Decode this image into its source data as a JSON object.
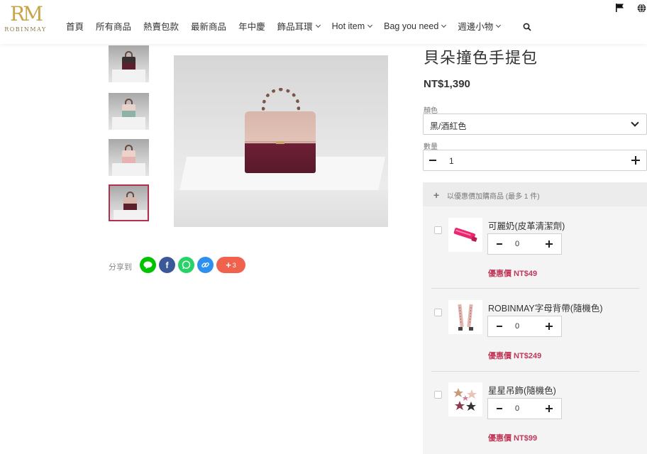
{
  "brand": {
    "logo_mark": "RM",
    "logo_text": "ROBINMAY"
  },
  "nav": {
    "items": [
      {
        "label": "首頁",
        "dropdown": false
      },
      {
        "label": "所有商品",
        "dropdown": false
      },
      {
        "label": "熱賣包款",
        "dropdown": false
      },
      {
        "label": "最新商品",
        "dropdown": false
      },
      {
        "label": "年中慶",
        "dropdown": false
      },
      {
        "label": "飾品耳環",
        "dropdown": true
      },
      {
        "label": "Hot item",
        "dropdown": true
      },
      {
        "label": "Bag you need",
        "dropdown": true
      },
      {
        "label": "週邊小物",
        "dropdown": true
      }
    ],
    "icons": [
      "search-icon",
      "flag-icon",
      "globe-icon"
    ]
  },
  "gallery": {
    "thumbnails": [
      {
        "top_color": "#3a2f30",
        "bottom_color": "#5c1f2c",
        "active": false
      },
      {
        "top_color": "#e7d3cc",
        "bottom_color": "#8fb2a8",
        "active": false
      },
      {
        "top_color": "#ecd2c8",
        "bottom_color": "#e6b3b3",
        "active": false
      },
      {
        "top_color": "#d9b8ac",
        "bottom_color": "#5c1f2c",
        "active": true
      }
    ]
  },
  "share": {
    "label": "分享到",
    "buttons": [
      {
        "name": "line-share-button",
        "icon": "line-icon",
        "color": "#00c300",
        "glyph": "●"
      },
      {
        "name": "facebook-share-button",
        "icon": "facebook-icon",
        "color": "#3b5998",
        "glyph": "f"
      },
      {
        "name": "whatsapp-share-button",
        "icon": "whatsapp-icon",
        "color": "#25d366",
        "glyph": "✆"
      },
      {
        "name": "copy-link-button",
        "icon": "link-icon",
        "color": "#2d8ff0",
        "glyph": "∞"
      }
    ],
    "more_plus": "+",
    "more_count": "3",
    "more_color": "#f0624d"
  },
  "product": {
    "title": "貝朵撞色手提包",
    "price": "NT$1,390",
    "color_label": "顏色",
    "color_value": "黑/酒紅色",
    "quantity_label": "數量",
    "quantity_value": "1"
  },
  "addons": {
    "header": "以優惠價加購商品 (最多 1 件)",
    "items": [
      {
        "name": "可麗奶(皮革清潔劑)",
        "quantity": "0",
        "price": "優惠價 NT$49",
        "icon": "cleaner-tube-icon"
      },
      {
        "name": "ROBINMAY字母背帶(隨機色)",
        "quantity": "0",
        "price": "優惠價 NT$249",
        "icon": "strap-icon"
      },
      {
        "name": "星星吊飾(隨機色)",
        "quantity": "0",
        "price": "優惠價 NT$99",
        "icon": "star-charm-icon"
      }
    ]
  },
  "colors": {
    "accent": "#c0395a",
    "active_thumb_border": "#b03050",
    "logo_gold": "#c9a54a"
  }
}
